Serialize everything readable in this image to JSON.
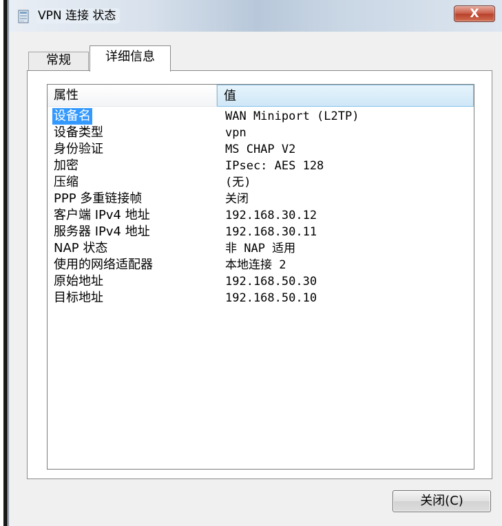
{
  "window": {
    "title": "VPN 连接 状态",
    "close_glyph": "X"
  },
  "tabs": [
    {
      "label": "常规",
      "active": false
    },
    {
      "label": "详细信息",
      "active": true
    }
  ],
  "details": {
    "columns": {
      "property": "属性",
      "value": "值"
    },
    "rows": [
      {
        "property": "设备名",
        "value": "WAN Miniport (L2TP)",
        "selected": true
      },
      {
        "property": "设备类型",
        "value": "vpn"
      },
      {
        "property": "身份验证",
        "value": "MS CHAP V2"
      },
      {
        "property": "加密",
        "value": "IPsec: AES 128"
      },
      {
        "property": "压缩",
        "value": "(无)"
      },
      {
        "property": "PPP 多重链接帧",
        "value": "关闭"
      },
      {
        "property": "客户端 IPv4 地址",
        "value": "192.168.30.12"
      },
      {
        "property": "服务器 IPv4 地址",
        "value": "192.168.30.11"
      },
      {
        "property": "NAP 状态",
        "value": "非 NAP 适用"
      },
      {
        "property": "使用的网络适配器",
        "value": "本地连接 2"
      },
      {
        "property": "原始地址",
        "value": "192.168.50.30"
      },
      {
        "property": "目标地址",
        "value": "192.168.50.10"
      }
    ]
  },
  "buttons": {
    "close_label": "关闭(C)"
  },
  "colors": {
    "selection": "#3399ff",
    "header_highlight": "#cfe7f7",
    "close_button": "#c75a45",
    "window_background": "#f0f0f0"
  }
}
